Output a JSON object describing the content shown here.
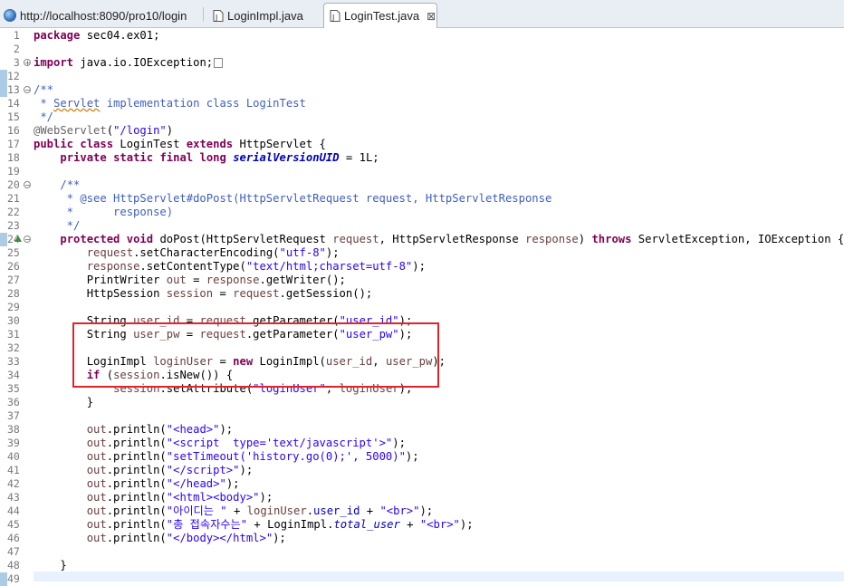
{
  "tabs": [
    {
      "label": "http://localhost:8090/pro10/login",
      "icon": "globe-icon",
      "active": false
    },
    {
      "label": "LoginImpl.java",
      "icon": "java-file-icon",
      "active": false
    },
    {
      "label": "LoginTest.java",
      "icon": "java-file-icon",
      "active": true,
      "close": "⊠"
    }
  ],
  "lines": [
    {
      "n": "1",
      "html": "<span class='kw'>package</span> sec04.ex01;"
    },
    {
      "n": "2",
      "html": ""
    },
    {
      "n": "3",
      "fold": "plus",
      "html": "<span class='kw'>import</span> java.io.IOException;<span class='fold-box'></span>"
    },
    {
      "n": "12",
      "mark": true,
      "html": ""
    },
    {
      "n": "13",
      "fold": "minus",
      "mark": true,
      "html": "<span class='cm'>/**</span>"
    },
    {
      "n": "14",
      "html": "<span class='cm'> * <span class='squiggle'>Servlet</span> implementation class LoginTest</span>"
    },
    {
      "n": "15",
      "html": "<span class='cm'> */</span>"
    },
    {
      "n": "16",
      "html": "<span class='ann'>@WebServlet</span>(<span class='str'>\"/login\"</span>)"
    },
    {
      "n": "17",
      "html": "<span class='kw'>public</span> <span class='kw'>class</span> LoginTest <span class='kw'>extends</span> HttpServlet {"
    },
    {
      "n": "18",
      "html": "    <span class='kw'>private</span> <span class='kw'>static</span> <span class='kw'>final</span> <span class='kw'>long</span> <span class='sfld'>serialVersionUID</span> = 1L;"
    },
    {
      "n": "19",
      "html": ""
    },
    {
      "n": "20",
      "fold": "minus",
      "html": "    <span class='cm'>/**</span>"
    },
    {
      "n": "21",
      "html": "<span class='cm'>     * @see HttpServlet#doPost(HttpServletRequest request, HttpServletResponse</span>"
    },
    {
      "n": "22",
      "html": "<span class='cm'>     *      response)</span>"
    },
    {
      "n": "23",
      "html": "<span class='cm'>     */</span>"
    },
    {
      "n": "24",
      "fold": "minus",
      "mark": true,
      "override": true,
      "html": "    <span class='kw'>protected</span> <span class='kw'>void</span> doPost(HttpServletRequest <span class='param'>request</span>, HttpServletResponse <span class='param'>response</span>) <span class='kw'>throws</span> ServletException, IOException {"
    },
    {
      "n": "25",
      "html": "        <span class='param'>request</span>.setCharacterEncoding(<span class='str'>\"utf-8\"</span>);"
    },
    {
      "n": "26",
      "html": "        <span class='param'>response</span>.setContentType(<span class='str'>\"text/html;charset=utf-8\"</span>);"
    },
    {
      "n": "27",
      "html": "        PrintWriter <span class='param'>out</span> = <span class='param'>response</span>.getWriter();"
    },
    {
      "n": "28",
      "html": "        HttpSession <span class='param'>session</span> = <span class='param'>request</span>.getSession();"
    },
    {
      "n": "29",
      "html": ""
    },
    {
      "n": "30",
      "html": "        String <span class='param'>user_id</span> = <span class='param'>request</span>.getParameter(<span class='str'>\"user_id\"</span>);"
    },
    {
      "n": "31",
      "html": "        String <span class='param'>user_pw</span> = <span class='param'>request</span>.getParameter(<span class='str'>\"user_pw\"</span>);"
    },
    {
      "n": "32",
      "html": ""
    },
    {
      "n": "33",
      "html": "        LoginImpl <span class='param'>loginUser</span> = <span class='kw'>new</span> LoginImpl(<span class='param'>user_id</span>, <span class='param'>user_pw</span>);"
    },
    {
      "n": "34",
      "html": "        <span class='kw'>if</span> (<span class='param'>session</span>.isNew()) {"
    },
    {
      "n": "35",
      "html": "            <span class='param'>session</span>.setAttribute(<span class='str'>\"loginUser\"</span>, <span class='param'>loginUser</span>);"
    },
    {
      "n": "36",
      "html": "        }"
    },
    {
      "n": "37",
      "html": ""
    },
    {
      "n": "38",
      "html": "        <span class='param'>out</span>.println(<span class='str'>\"&lt;head&gt;\"</span>);"
    },
    {
      "n": "39",
      "html": "        <span class='param'>out</span>.println(<span class='str'>\"&lt;script  type='text/javascript'&gt;\"</span>);"
    },
    {
      "n": "40",
      "html": "        <span class='param'>out</span>.println(<span class='str'>\"setTimeout('history.go(0);', 5000)\"</span>);"
    },
    {
      "n": "41",
      "html": "        <span class='param'>out</span>.println(<span class='str'>\"&lt;/script&gt;\"</span>);"
    },
    {
      "n": "42",
      "html": "        <span class='param'>out</span>.println(<span class='str'>\"&lt;/head&gt;\"</span>);"
    },
    {
      "n": "43",
      "html": "        <span class='param'>out</span>.println(<span class='str'>\"&lt;html&gt;&lt;body&gt;\"</span>);"
    },
    {
      "n": "44",
      "html": "        <span class='param'>out</span>.println(<span class='str'>\"아이디는 \"</span> + <span class='param'>loginUser</span>.<span class='fld'>user_id</span> + <span class='str'>\"&lt;br&gt;\"</span>);"
    },
    {
      "n": "45",
      "html": "        <span class='param'>out</span>.println(<span class='str'>\"총 접속자수는\"</span> + LoginImpl.<span class='sfld' style='font-weight:normal'>total_user</span> + <span class='str'>\"&lt;br&gt;\"</span>);"
    },
    {
      "n": "46",
      "html": "        <span class='param'>out</span>.println(<span class='str'>\"&lt;/body&gt;&lt;/html&gt;\"</span>);"
    },
    {
      "n": "47",
      "html": ""
    },
    {
      "n": "48",
      "html": "    }"
    },
    {
      "n": "49",
      "mark": true,
      "html": ""
    }
  ]
}
